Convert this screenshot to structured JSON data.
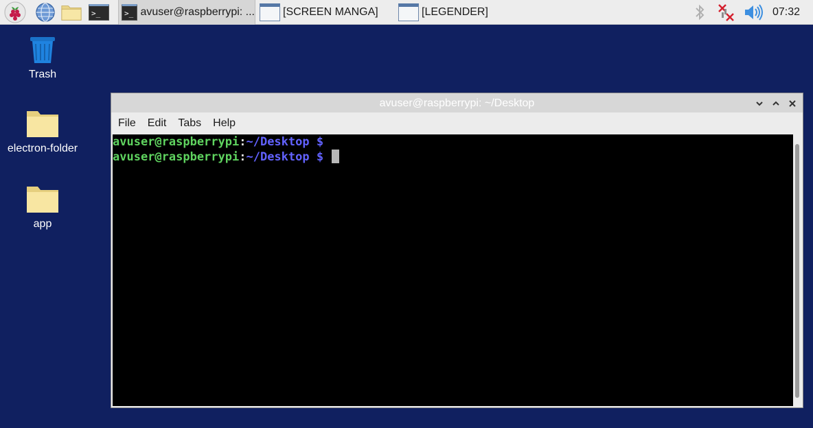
{
  "taskbar": {
    "launchers": [
      {
        "name": "raspberry-menu",
        "icon": "raspberry-icon"
      },
      {
        "name": "web-browser",
        "icon": "globe-icon"
      },
      {
        "name": "file-manager",
        "icon": "folder-icon"
      },
      {
        "name": "terminal",
        "icon": "terminal-icon"
      }
    ],
    "tasks": [
      {
        "label": "avuser@raspberrypi: ...",
        "icon": "terminal-icon",
        "active": true
      },
      {
        "label": "[SCREEN MANGA]",
        "icon": "window-icon",
        "active": false
      },
      {
        "label": "[LEGENDER]",
        "icon": "window-icon",
        "active": false
      }
    ],
    "tray": {
      "bluetooth_icon": "bluetooth-icon",
      "network_icon": "network-disconnected-icon",
      "volume_icon": "volume-icon"
    },
    "clock": "07:32"
  },
  "desktop": {
    "icons": [
      {
        "label": "Trash",
        "icon": "trash-icon"
      },
      {
        "label": "electron-folder",
        "icon": "folder-icon"
      },
      {
        "label": "app",
        "icon": "folder-icon"
      }
    ]
  },
  "terminal_window": {
    "title": "avuser@raspberrypi: ~/Desktop",
    "menu": [
      "File",
      "Edit",
      "Tabs",
      "Help"
    ],
    "lines": [
      {
        "user": "avuser@raspberrypi",
        "sep": ":",
        "path": "~/Desktop $",
        "cursor": false
      },
      {
        "user": "avuser@raspberrypi",
        "sep": ":",
        "path": "~/Desktop $",
        "cursor": true
      }
    ]
  },
  "colors": {
    "desktop_bg": "#102060",
    "prompt_user": "#5fd35f",
    "prompt_path": "#6262ff",
    "terminal_bg": "#000000"
  }
}
